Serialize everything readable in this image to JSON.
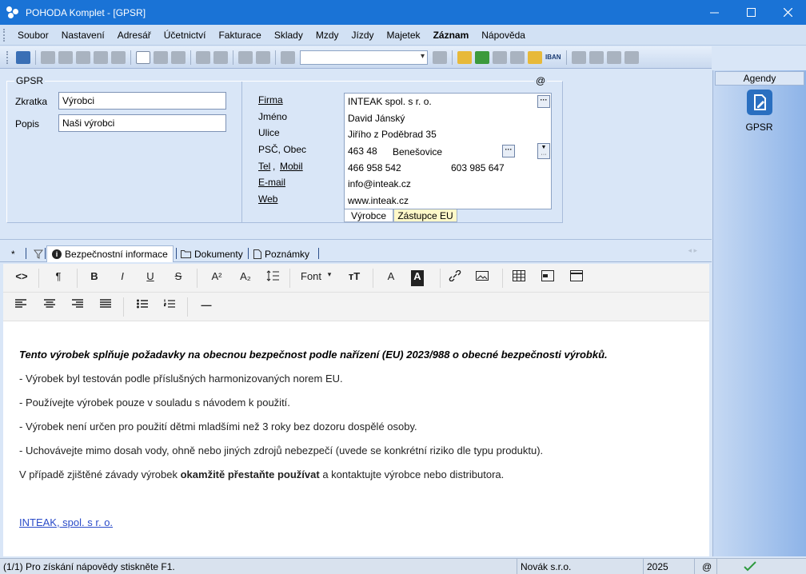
{
  "window": {
    "title": "POHODA Komplet - [GPSR]"
  },
  "menu": [
    "Soubor",
    "Nastavení",
    "Adresář",
    "Účetnictví",
    "Fakturace",
    "Sklady",
    "Mzdy",
    "Jízdy",
    "Majetek",
    "Záznam",
    "Nápověda"
  ],
  "toolbar": {
    "iban_label": "IBAN",
    "search_value": ""
  },
  "form": {
    "group_title": "GPSR",
    "at_symbol": "@",
    "zkratka_label": "Zkratka",
    "zkratka_value": "Výrobci",
    "popis_label": "Popis",
    "popis_value": "Naši výrobci",
    "labels": {
      "firma": "Firma",
      "jmeno": "Jméno",
      "ulice": "Ulice",
      "psc_obec": "PSČ, Obec",
      "tel": "Tel",
      "comma": ",",
      "mobil": "Mobil",
      "email": "E-mail",
      "web": "Web"
    },
    "values": {
      "firma": "INTEAK spol. s r. o.",
      "jmeno": "David Jánský",
      "ulice": "Jiřího z Poděbrad 35",
      "psc": "463 48",
      "obec": "Benešovice",
      "tel": "466 958 542",
      "mobil": "603 985 647",
      "email": "info@inteak.cz",
      "web": "www.inteak.cz"
    },
    "subtabs": [
      "Výrobce",
      "Zástupce EU"
    ]
  },
  "agendas": {
    "header": "Agendy",
    "item_label": "GPSR"
  },
  "tabs": {
    "star": "*",
    "items": [
      "Bezpečnostní informace",
      "Dokumenty",
      "Poznámky"
    ]
  },
  "editor_toolbar": {
    "code": "<>",
    "pilcrow": "¶",
    "bold": "B",
    "italic": "I",
    "underline": "U",
    "strike": "S",
    "superscript": "A²",
    "subscript": "A₂",
    "font": "Font",
    "fontsize": "тT",
    "color": "A",
    "bgcolor": "A",
    "hr": "—"
  },
  "editor": {
    "heading": "Tento výrobek splňuje požadavky na obecnou bezpečnost podle nařízení (EU) 2023/988 o obecné bezpečnosti výrobků.",
    "line1": "- Výrobek byl testován podle příslušných harmonizovaných norem EU.",
    "line2": "- Používejte výrobek pouze v souladu s návodem k použití.",
    "line3": "- Výrobek není určen pro použití dětmi mladšími než 3 roky bez dozoru dospělé osoby.",
    "line4": "- Uchovávejte mimo dosah vody, ohně nebo jiných zdrojů nebezpečí (uvede se konkrétní riziko dle typu produktu).",
    "line5_pre": "V případě zjištěné závady výrobek ",
    "line5_bold": "okamžitě přestaňte používat",
    "line5_post": " a kontaktujte výrobce nebo distributora.",
    "link": "INTEAK, spol. s r. o."
  },
  "status": {
    "help": "(1/1) Pro získání nápovědy stiskněte F1.",
    "company": "Novák s.r.o.",
    "year": "2025",
    "at": "@"
  }
}
